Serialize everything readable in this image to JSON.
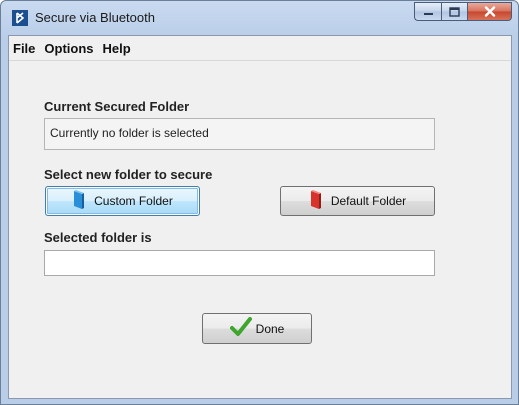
{
  "window": {
    "title": "Secure via Bluetooth",
    "icon": "app-icon"
  },
  "titlebar_controls": [
    "minimize-icon",
    "maximize-icon",
    "close-icon"
  ],
  "menu": {
    "items": [
      "File",
      "Options",
      "Help"
    ]
  },
  "current_section": {
    "label": "Current Secured Folder",
    "value": "Currently no folder is selected"
  },
  "select_section": {
    "label": "Select new folder to secure",
    "custom_button": "Custom Folder",
    "custom_icon": "blue-book-icon",
    "default_button": "Default Folder",
    "default_icon": "red-book-icon"
  },
  "selected_section": {
    "label": "Selected folder is",
    "value": ""
  },
  "done_button": {
    "label": "Done",
    "icon": "green-check-icon"
  },
  "colors": {
    "titlebar": "#c9daf0",
    "close_button": "#c6462b",
    "custom_icon": "#2a8fd9",
    "default_icon": "#d9322b",
    "check": "#3fa52c"
  }
}
